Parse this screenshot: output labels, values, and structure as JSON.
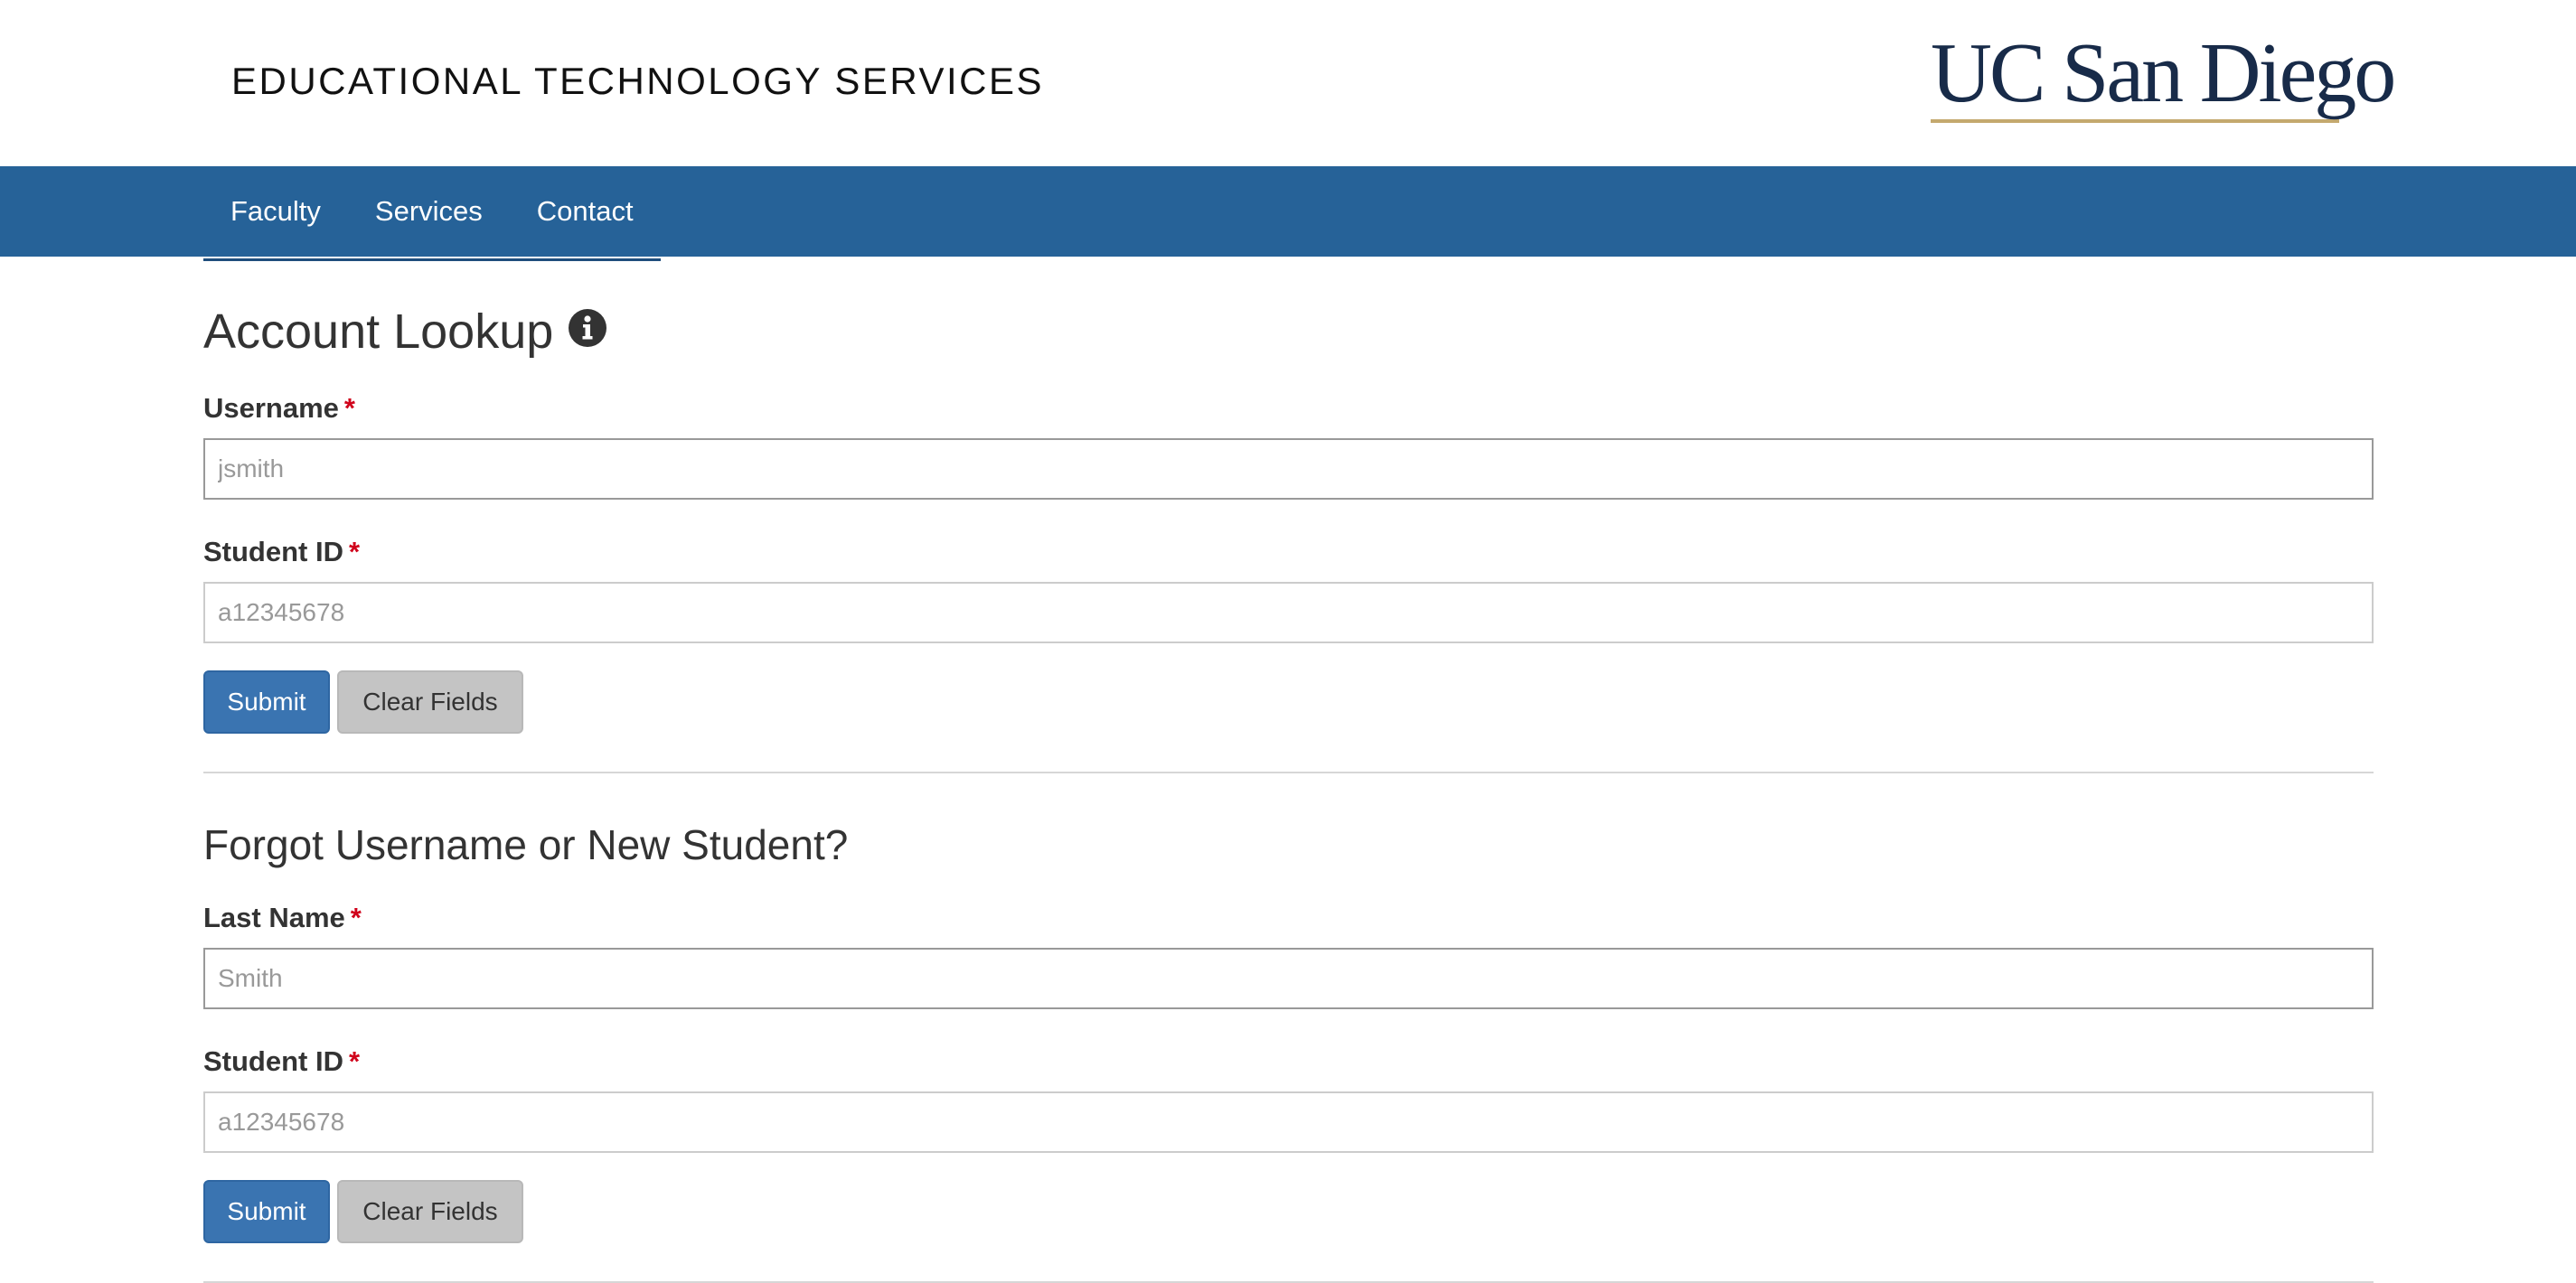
{
  "header": {
    "site_title": "EDUCATIONAL TECHNOLOGY SERVICES",
    "logo_text": "UC San Diego"
  },
  "nav": {
    "items": [
      {
        "label": "Faculty"
      },
      {
        "label": "Services"
      },
      {
        "label": "Contact"
      }
    ]
  },
  "account_lookup": {
    "title": "Account Lookup",
    "info_icon": "info-circle-icon",
    "username_label": "Username",
    "username_placeholder": "jsmith",
    "student_id_label": "Student ID",
    "student_id_placeholder": "a12345678",
    "required_marker": "*",
    "submit_label": "Submit",
    "clear_label": "Clear Fields"
  },
  "forgot_username": {
    "title": "Forgot Username or New Student?",
    "last_name_label": "Last Name",
    "last_name_placeholder": "Smith",
    "student_id_label": "Student ID",
    "student_id_placeholder": "a12345678",
    "required_marker": "*",
    "submit_label": "Submit",
    "clear_label": "Clear Fields"
  },
  "colors": {
    "nav_background": "#266298",
    "logo_navy": "#182b49",
    "logo_gold": "#c4a96e",
    "submit_button": "#3a74b1",
    "clear_button": "#c4c4c4",
    "required_star": "#d0021b"
  }
}
